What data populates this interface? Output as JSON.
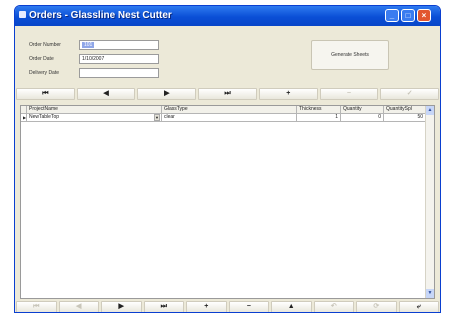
{
  "window": {
    "title": "Orders - Glassline Nest Cutter",
    "minimize_glyph": "_",
    "maximize_glyph": "□",
    "close_glyph": "×"
  },
  "form": {
    "order_number_label": "Order Number",
    "order_number_value": "101",
    "order_date_label": "Order Date",
    "order_date_value": "1/10/2007",
    "delivery_date_label": "Delivery Date",
    "delivery_date_value": "",
    "generate_sheets_label": "Generate Sheets"
  },
  "nav_top": [
    {
      "icon": "first-record-icon",
      "glyph": "⏮",
      "enabled": true
    },
    {
      "icon": "previous-record-icon",
      "glyph": "◀",
      "enabled": true
    },
    {
      "icon": "next-record-icon",
      "glyph": "▶",
      "enabled": true
    },
    {
      "icon": "last-record-icon",
      "glyph": "⏭",
      "enabled": true
    },
    {
      "icon": "add-record-icon",
      "glyph": "+",
      "enabled": true
    },
    {
      "icon": "delete-record-icon",
      "glyph": "−",
      "enabled": false
    },
    {
      "icon": "save-record-icon",
      "glyph": "✓",
      "enabled": false
    }
  ],
  "grid": {
    "columns": [
      "ProjectName",
      "GlassType",
      "Thickness",
      "Quantity",
      "QuantitySpl"
    ],
    "rows": [
      {
        "marker": "▶",
        "project": "NewTableTop",
        "dropdown": "▼",
        "glass": "clear",
        "thickness": "1",
        "quantity": "0",
        "quantity_spl": "50"
      }
    ]
  },
  "nav_bottom": [
    {
      "icon": "first-record-icon",
      "glyph": "⏮",
      "enabled": false
    },
    {
      "icon": "previous-record-icon",
      "glyph": "◀",
      "enabled": false
    },
    {
      "icon": "next-record-icon",
      "glyph": "▶",
      "enabled": true
    },
    {
      "icon": "last-record-icon",
      "glyph": "⏭",
      "enabled": true
    },
    {
      "icon": "add-record-icon",
      "glyph": "+",
      "enabled": true
    },
    {
      "icon": "delete-record-icon",
      "glyph": "−",
      "enabled": true
    },
    {
      "icon": "save-record-icon",
      "glyph": "▲",
      "enabled": true
    },
    {
      "icon": "undo-icon",
      "glyph": "↶",
      "enabled": false
    },
    {
      "icon": "refresh-icon",
      "glyph": "⟳",
      "enabled": false
    },
    {
      "icon": "grid-options-icon",
      "glyph": "⤶",
      "enabled": true
    }
  ],
  "colors": {
    "titlebar": "#0a4fd6",
    "window_face": "#ece9d8",
    "close_button": "#e2562f"
  }
}
